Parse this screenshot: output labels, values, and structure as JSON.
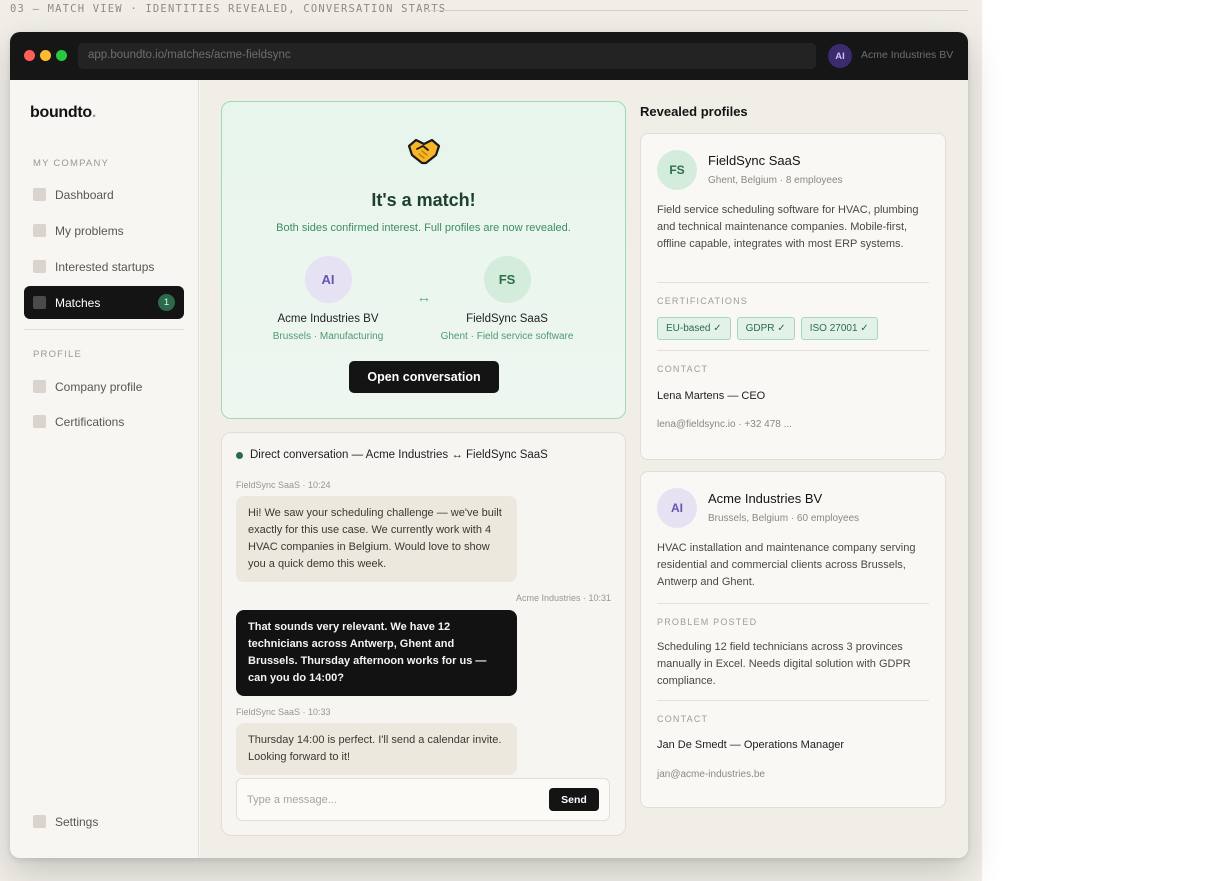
{
  "caption": "03 — MATCH VIEW · IDENTITIES REVEALED, CONVERSATION STARTS",
  "browser": {
    "url": "app.boundto.io/matches/acme-fieldsync",
    "avatar_initials": "AI",
    "org_name": "Acme Industries BV"
  },
  "sidebar": {
    "brand": "boundto",
    "brand_dot": ".",
    "section_company": "MY COMPANY",
    "items": [
      {
        "label": "Dashboard"
      },
      {
        "label": "My problems"
      },
      {
        "label": "Interested startups"
      },
      {
        "label": "Matches",
        "badge": "1"
      }
    ],
    "section_profile": "PROFILE",
    "profile_items": [
      {
        "label": "Company profile"
      },
      {
        "label": "Certifications"
      }
    ],
    "settings_label": "Settings"
  },
  "match": {
    "title": "It's a match!",
    "subtitle": "Both sides confirmed interest. Full profiles are now revealed.",
    "exchange_symbol": "↔",
    "left": {
      "initials": "AI",
      "name": "Acme Industries BV",
      "meta": "Brussels · Manufacturing"
    },
    "right": {
      "initials": "FS",
      "name": "FieldSync SaaS",
      "meta": "Ghent · Field service software"
    },
    "open_button": "Open conversation"
  },
  "conversation": {
    "header": "Direct conversation — Acme Industries ↔ FieldSync SaaS",
    "messages": [
      {
        "meta": "FieldSync SaaS · 10:24",
        "text": "Hi! We saw your scheduling challenge — we've built exactly for this use case. We currently work with 4 HVAC companies in Belgium. Would love to show you a quick demo this week."
      },
      {
        "meta": "Acme Industries · 10:31",
        "text": "That sounds very relevant. We have 12 technicians across Antwerp, Ghent and Brussels. Thursday afternoon works for us — can you do 14:00?"
      },
      {
        "meta": "FieldSync SaaS · 10:33",
        "text": "Thursday 14:00 is perfect. I'll send a calendar invite. Looking forward to it!"
      }
    ],
    "input_placeholder": "Type a message...",
    "send_label": "Send"
  },
  "profiles": {
    "title": "Revealed profiles",
    "fieldsync": {
      "initials": "FS",
      "name": "FieldSync SaaS",
      "location": "Ghent, Belgium · 8 employees",
      "description": "Field service scheduling software for HVAC, plumbing and technical maintenance companies. Mobile-first, offline capable, integrates with most ERP systems.",
      "cert_label": "CERTIFICATIONS",
      "certs": [
        "EU-based ✓",
        "GDPR ✓",
        "ISO 27001 ✓"
      ],
      "contact_label": "CONTACT",
      "contact_name": "Lena Martens — CEO",
      "contact_details": "lena@fieldsync.io · +32 478 ..."
    },
    "acme": {
      "initials": "AI",
      "name": "Acme Industries BV",
      "location": "Brussels, Belgium · 60 employees",
      "description": "HVAC installation and maintenance company serving residential and commercial clients across Brussels, Antwerp and Ghent.",
      "problem_label": "PROBLEM POSTED",
      "problem": "Scheduling 12 field technicians across 3 provinces manually in Excel. Needs digital solution with GDPR compliance.",
      "contact_label": "CONTACT",
      "contact_name": "Jan De Smedt — Operations Manager",
      "contact_details": "jan@acme-industries.be"
    }
  },
  "colors": {
    "accent_green": "#2b6b4b",
    "match_border": "#9fdab5",
    "dark": "#141414",
    "purple": "#6a54b3"
  }
}
